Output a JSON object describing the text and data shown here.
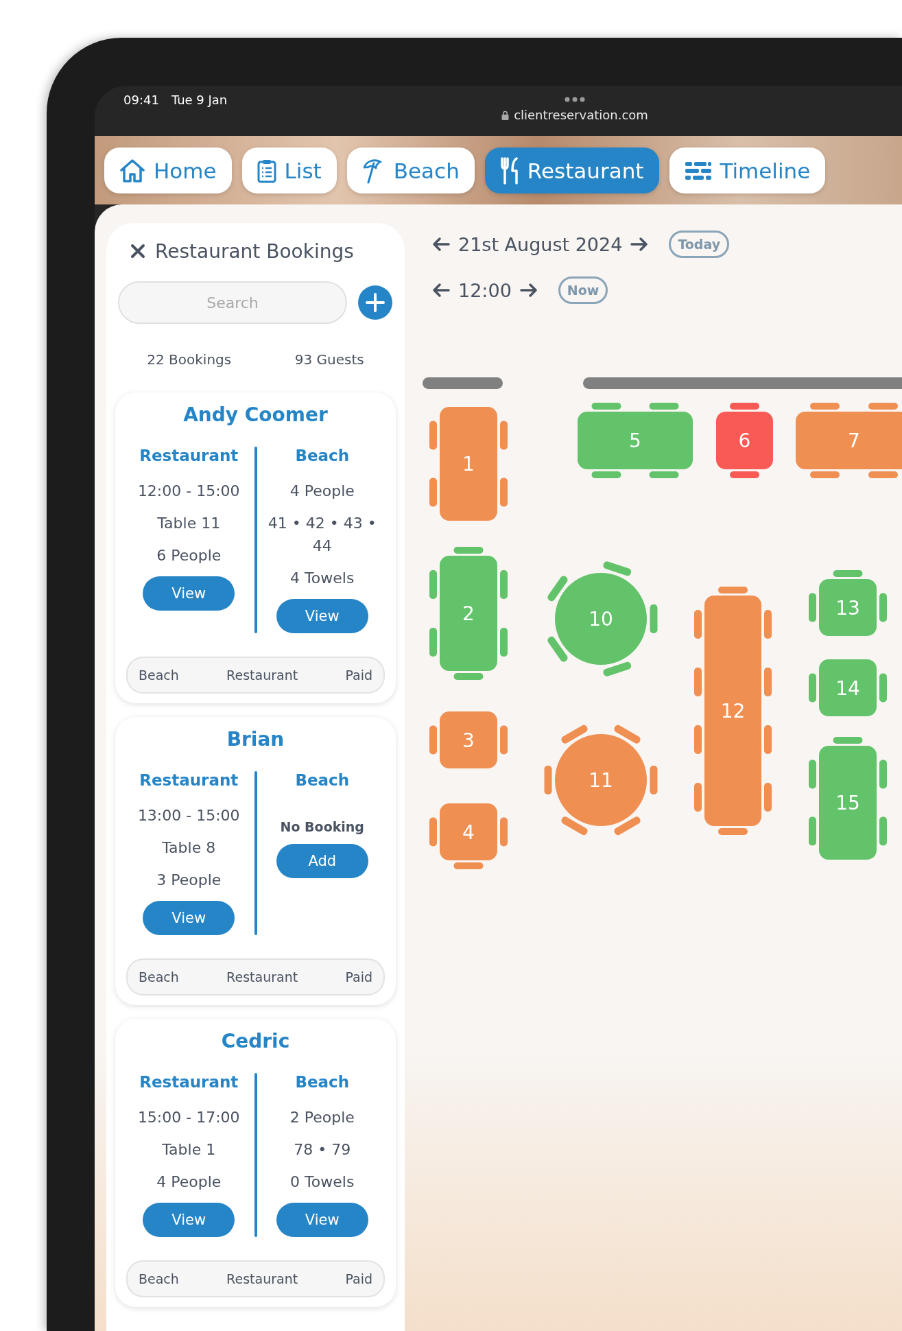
{
  "status_bar": {
    "time": "09:41",
    "date": "Tue 9 Jan",
    "url": "clientreservation.com"
  },
  "nav_tabs": [
    {
      "label": "Home",
      "kind": "home",
      "selected": false
    },
    {
      "label": "List",
      "kind": "list",
      "selected": false
    },
    {
      "label": "Beach",
      "kind": "beach",
      "selected": false
    },
    {
      "label": "Restaurant",
      "kind": "restaurant",
      "selected": true
    },
    {
      "label": "Timeline",
      "kind": "timeline",
      "selected": false
    }
  ],
  "sidebar": {
    "title": "Restaurant Bookings",
    "search": {
      "placeholder": "Search"
    },
    "bookings_count": "22 Bookings",
    "guests_count": "93 Guests"
  },
  "bookings": [
    {
      "name": "Andy Coomer",
      "restaurant": {
        "heading": "Restaurant",
        "lines": [
          "12:00 - 15:00",
          "Table 11",
          "6 People"
        ],
        "button": "View"
      },
      "beach": {
        "heading": "Beach",
        "lines": [
          "4 People",
          "41 • 42 • 43 • 44",
          "4 Towels"
        ],
        "button": "View"
      },
      "tags": [
        "Beach",
        "Restaurant",
        "Paid"
      ]
    },
    {
      "name": "Brian",
      "restaurant": {
        "heading": "Restaurant",
        "lines": [
          "13:00 - 15:00",
          "Table 8",
          "3 People"
        ],
        "button": "View"
      },
      "beach": {
        "heading": "Beach",
        "note": "No Booking",
        "button": "Add"
      },
      "tags": [
        "Beach",
        "Restaurant",
        "Paid"
      ]
    },
    {
      "name": "Cedric",
      "restaurant": {
        "heading": "Restaurant",
        "lines": [
          "15:00 - 17:00",
          "Table 1",
          "4 People"
        ],
        "button": "View"
      },
      "beach": {
        "heading": "Beach",
        "lines": [
          "2 People",
          "78 • 79",
          "0 Towels"
        ],
        "button": "View"
      },
      "tags": [
        "Beach",
        "Restaurant",
        "Paid"
      ]
    }
  ],
  "floor": {
    "date": "21st August 2024",
    "today_button": "Today",
    "time": "12:00",
    "now_button": "Now",
    "tables": [
      {
        "number": "1",
        "color": "#f08f52"
      },
      {
        "number": "2",
        "color": "#62c36a"
      },
      {
        "number": "3",
        "color": "#f08f52"
      },
      {
        "number": "4",
        "color": "#f08f52"
      },
      {
        "number": "5",
        "color": "#62c36a"
      },
      {
        "number": "6",
        "color": "#fa5a56"
      },
      {
        "number": "7",
        "color": "#f08f52"
      },
      {
        "number": "10",
        "color": "#62c36a"
      },
      {
        "number": "11",
        "color": "#f08f52"
      },
      {
        "number": "12",
        "color": "#f08f52"
      },
      {
        "number": "13",
        "color": "#62c36a"
      },
      {
        "number": "14",
        "color": "#62c36a"
      },
      {
        "number": "15",
        "color": "#62c36a"
      }
    ]
  }
}
